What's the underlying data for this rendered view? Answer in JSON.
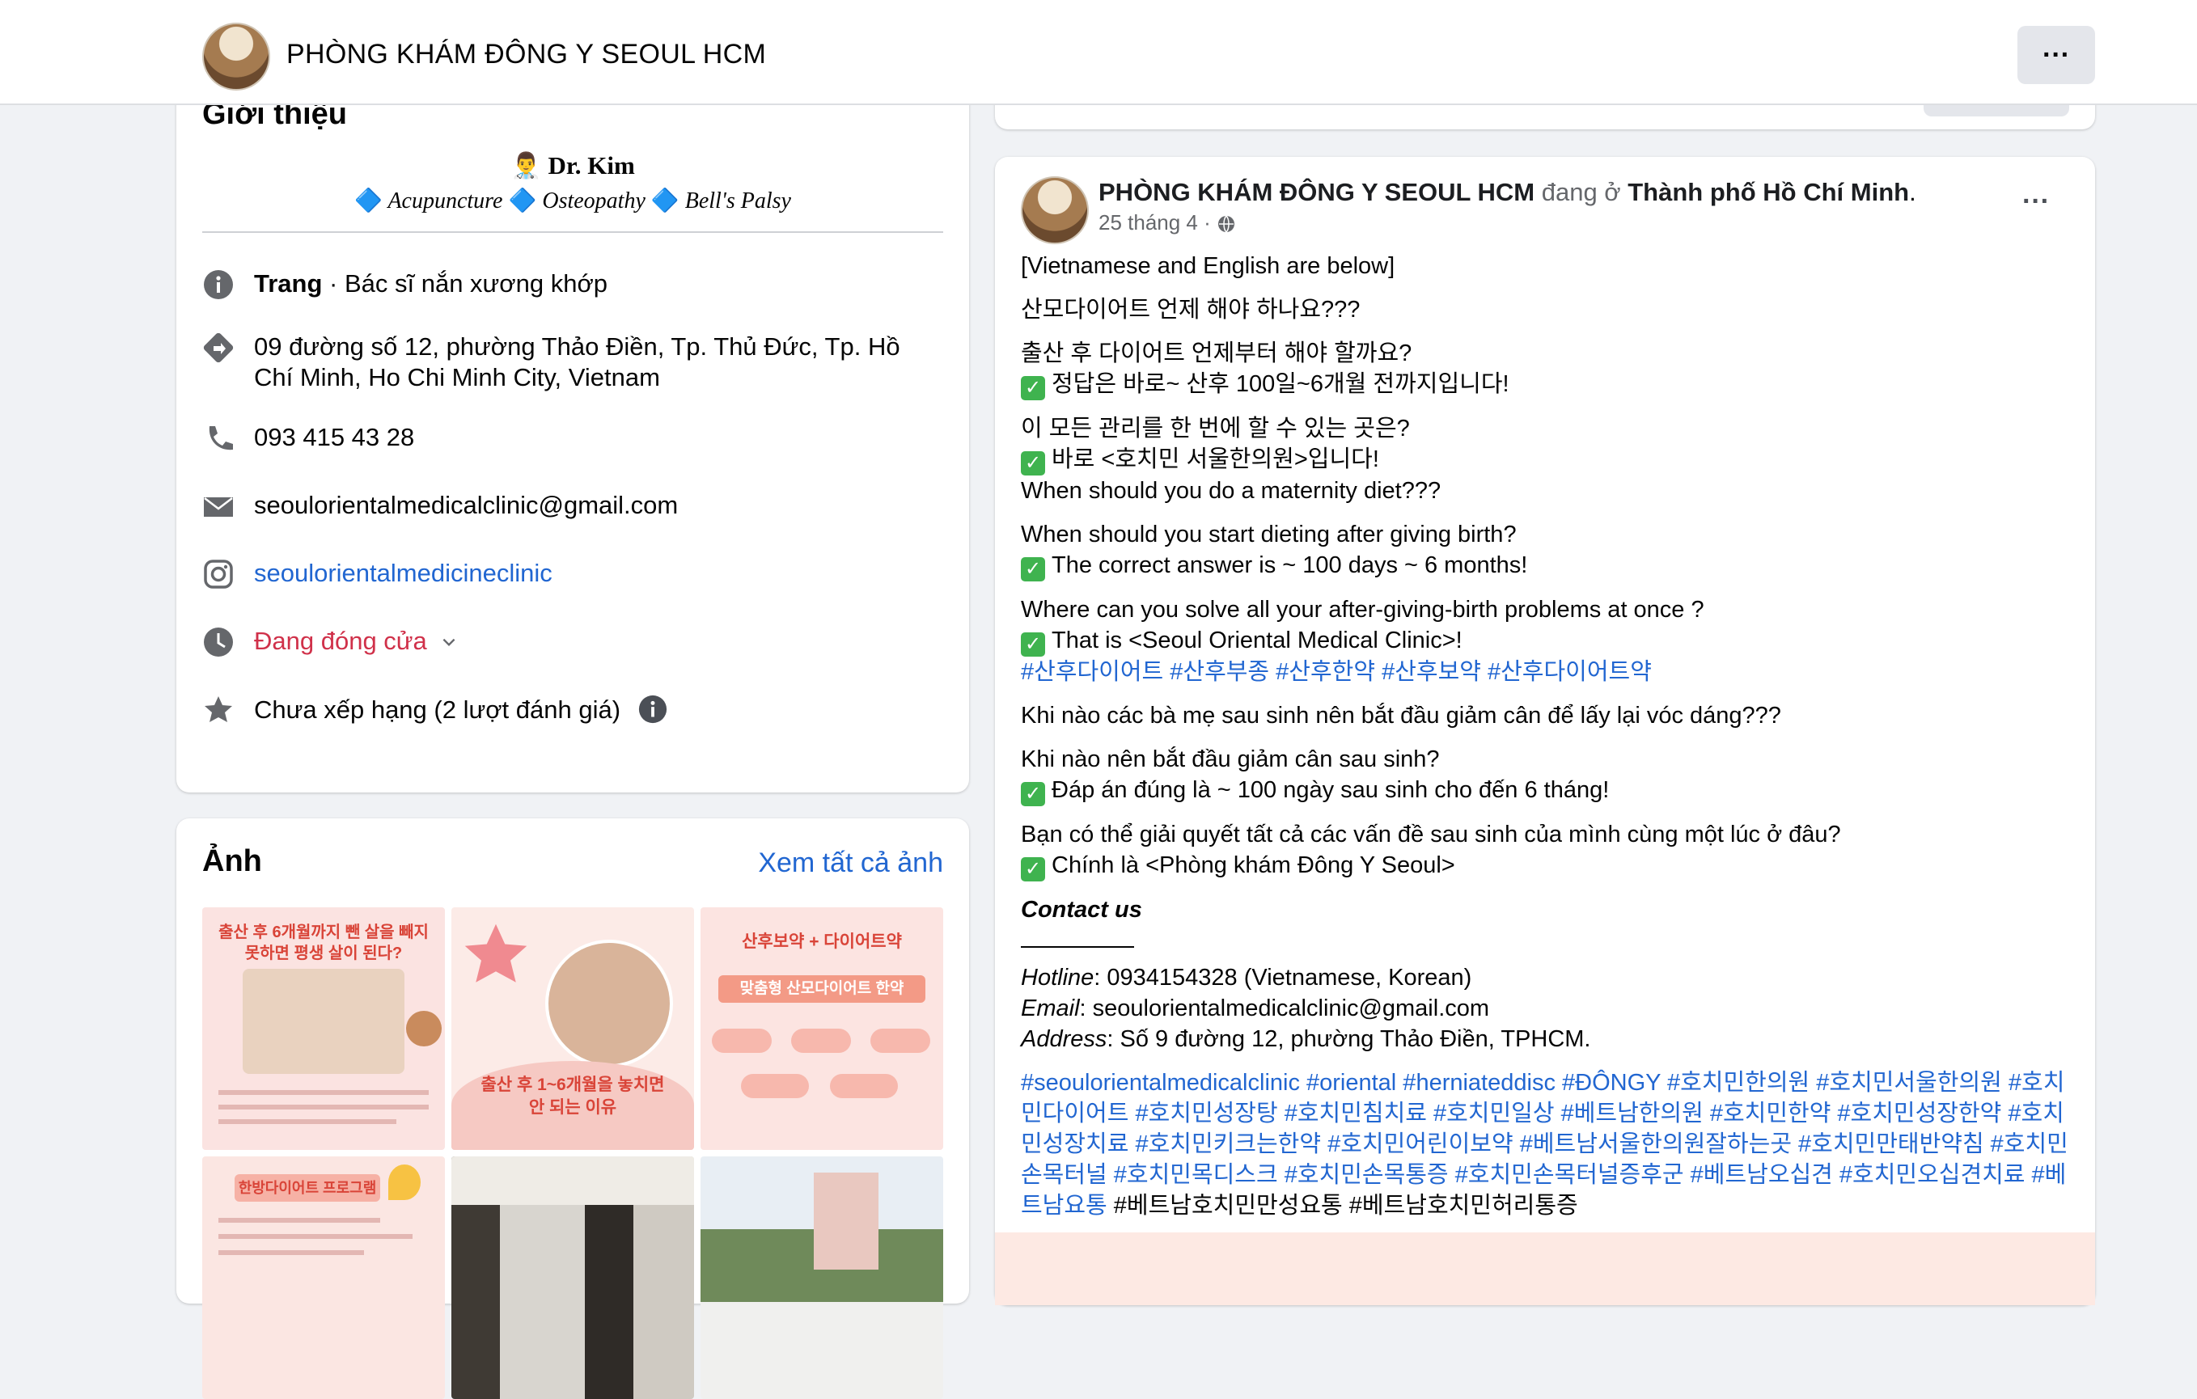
{
  "header": {
    "title": "PHÒNG KHÁM ĐÔNG Y SEOUL HCM",
    "more_label": "···"
  },
  "intro": {
    "heading": "Giới thiệu",
    "bio_line1": "Dr. Kim",
    "bio_items": [
      "Acupuncture",
      "Osteopathy",
      "Bell's Palsy"
    ],
    "category_label": "Trang",
    "category_value": " · Bác sĩ nắn xương khớp",
    "address": "09 đường số 12, phường Thảo Điền, Tp. Thủ Đức, Tp. Hồ Chí Minh, Ho Chi Minh City, Vietnam",
    "phone": "093 415 43 28",
    "email": "seoulorientalmedicalclinic@gmail.com",
    "instagram": "seoulorientalmedicineclinic",
    "hours_status": "Đang đóng cửa",
    "rating": "Chưa xếp hạng (2 lượt đánh giá)"
  },
  "photos": {
    "heading": "Ảnh",
    "see_all": "Xem tất cả ảnh",
    "tiles": [
      {
        "caption": "출산 후 6개월까지 뺀 살을 빼지 못하면 평생 살이 된다?"
      },
      {
        "caption": "출산 후 1~6개월을 놓치면 안 되는 이유"
      },
      {
        "caption": "산후보약 + 다이어트약",
        "subcaption": "맞춤형 산모다이어트 한약"
      },
      {
        "caption": "한방다이어트 프로그램"
      }
    ]
  },
  "post": {
    "author": "PHÒNG KHÁM ĐÔNG Y SEOUL HCM",
    "at_text": " đang ở ",
    "location": "Thành phố Hồ Chí Minh",
    "date": "25 tháng 4 · ",
    "more_label": "···",
    "lines": {
      "l1": "[Vietnamese and English are below]",
      "l2": "산모다이어트 언제 해야 하나요???",
      "l3": "출산 후 다이어트 언제부터 해야 할까요?",
      "l4": "정답은 바로~ 산후 100일~6개월 전까지입니다!",
      "l5": "이 모든 관리를 한 번에 할 수 있는 곳은?",
      "l6": "바로 <호치민 서울한의원>입니다!",
      "l7": "When should you do a maternity diet???",
      "l8": "When should you start dieting after giving birth?",
      "l9": "The correct answer is ~ 100 days ~ 6 months!",
      "l10": "Where can you solve all your after-giving-birth problems at once ?",
      "l11": "That is <Seoul Oriental Medical Clinic>!",
      "tags1": "#산후다이어트 #산후부종 #산후한약 #산후보약 #산후다이어트약",
      "l12": "Khi nào các bà mẹ sau sinh nên bắt đầu giảm cân để lấy lại vóc dáng???",
      "l13": "Khi nào nên bắt đầu giảm cân sau sinh?",
      "l14": "Đáp án đúng là ~ 100 ngày sau sinh cho đến 6 tháng!",
      "l15": "Bạn có thể giải quyết tất cả các vấn đề sau sinh của mình cùng một lúc ở đâu?",
      "l16": "Chính là <Phòng khám Đông Y Seoul>",
      "contact_title": "Contact us",
      "hotline_label": "Hotline",
      "hotline_value": ": 0934154328 (Vietnamese, Korean)",
      "email_label": "Email",
      "email_value": ": seoulorientalmedicalclinic@gmail.com",
      "address_label": "Address",
      "address_value": ": Số 9 đường 12, phường Thảo Điền, TPHCM.",
      "tags2": "#seoulorientalmedicalclinic #oriental #herniateddisc #ĐÔNGY #호치민한의원 #호치민서울한의원 #호치민다이어트 #호치민성장탕 #호치민침치료 #호치민일상 #베트남한의원 #호치민한약 #호치민성장한약 #호치민성장치료 #호치민키크는한약 #호치민어린이보약 #베트남서울한의원잘하는곳 #호치민만태반약침 #호치민손목터널 #호치민목디스크 #호치민손목통증 #호치민손목터널증후군 #베트남오십견 #호치민오십견치료 #베트남요통",
      "tags2_plain": " #베트남호치민만성요통 #베트남호치민허리통증"
    }
  }
}
